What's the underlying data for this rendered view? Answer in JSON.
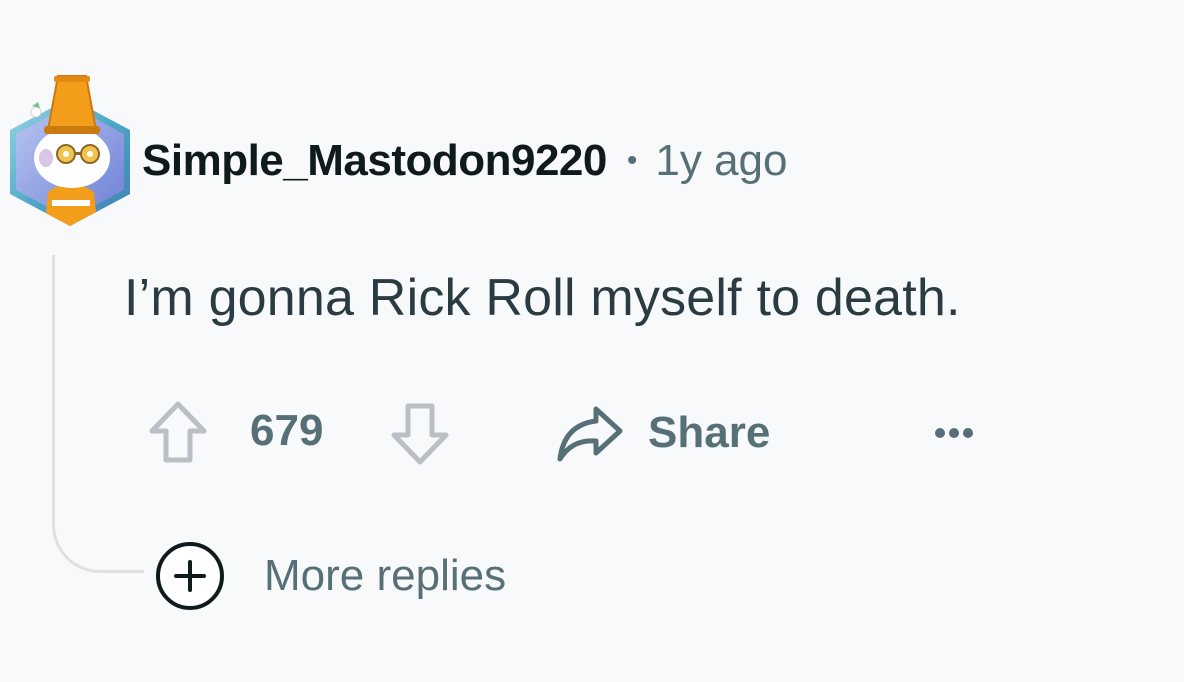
{
  "comment": {
    "username": "Simple_Mastodon9220",
    "separator": "•",
    "timestamp": "1y ago",
    "body": "I’m gonna Rick Roll myself to death.",
    "avatar_icon": "snoo-avatar-traffic-cone-hat"
  },
  "actions": {
    "upvote_icon": "arrow-up-outline-icon",
    "vote_count": "679",
    "downvote_icon": "arrow-down-outline-icon",
    "share_icon": "share-arrow-icon",
    "share_label": "Share",
    "more_icon": "overflow-horizontal-icon"
  },
  "more_replies": {
    "icon": "plus-circle-icon",
    "label": "More replies"
  },
  "colors": {
    "background": "#f8f9fb",
    "username": "#0f1a1c",
    "body_text": "#2a3c42",
    "secondary_text": "#576f76",
    "thread_line": "#dde1e6",
    "avatar_border": "#4ea8c7",
    "cone_orange": "#f29e1b"
  }
}
